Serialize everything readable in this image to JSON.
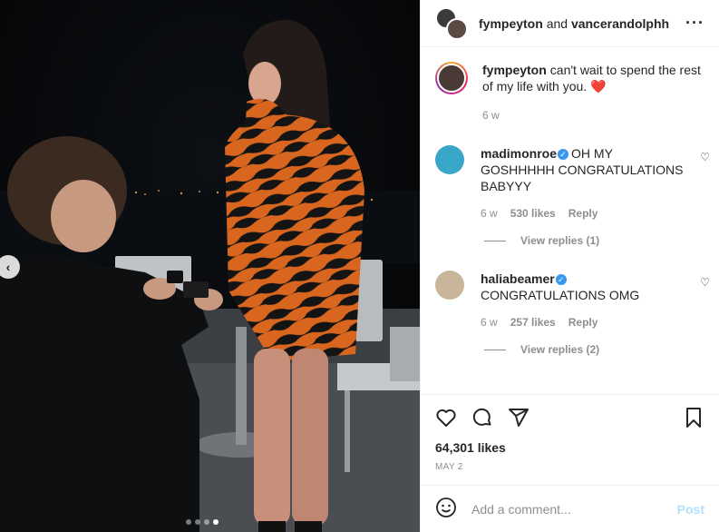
{
  "header": {
    "user1": "fympeyton",
    "joiner": "and",
    "user2": "vancerandolphh",
    "more_icon": "more-horizontal-icon"
  },
  "caption": {
    "username": "fympeyton",
    "text": "can't wait to spend the rest of my life with you.",
    "emoji": "❤️",
    "time": "6 w"
  },
  "comments": [
    {
      "username": "madimonroe",
      "verified": true,
      "text": "OH MY GOSHHHHH CONGRATULATIONS BABYYY",
      "time": "6 w",
      "likes": "530 likes",
      "reply": "Reply",
      "view_replies": "View replies (1)",
      "avatar_color": "#3aa7c9"
    },
    {
      "username": "haliabeamer",
      "verified": true,
      "text": "CONGRATULATIONS OMG",
      "time": "6 w",
      "likes": "257 likes",
      "reply": "Reply",
      "view_replies": "View replies (2)",
      "avatar_color": "#c9b59a"
    }
  ],
  "actions": {
    "like_icon": "heart-icon",
    "comment_icon": "comment-icon",
    "share_icon": "send-icon",
    "save_icon": "bookmark-icon"
  },
  "likes": "64,301 likes",
  "date": "MAY 2",
  "add_comment": {
    "placeholder": "Add a comment...",
    "post_label": "Post",
    "emoji_icon": "emoji-icon"
  },
  "carousel": {
    "prev_icon": "chevron-left-icon",
    "dot_count": 4,
    "active_dot": 4
  },
  "colors": {
    "accent": "#3897f0",
    "post_disabled": "#b2dffc",
    "like_red": "#ed4956"
  }
}
